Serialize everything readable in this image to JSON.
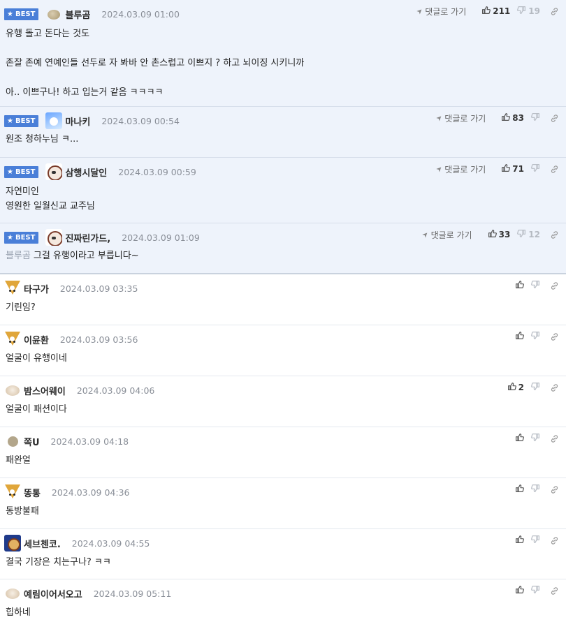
{
  "comments": [
    {
      "best": true,
      "badge": "BEST",
      "nick": "블루곰",
      "date": "2024.03.09 01:00",
      "avatar": "blob",
      "lines": [
        "유행 돌고 돈다는 것도",
        "",
        "존잘 존예 연예인들 선두로 자 봐바 안 촌스럽고 이쁘지 ? 하고 뇌이징 시키니까",
        "",
        "아.. 이쁘구나! 하고 입는거 같음 ㅋㅋㅋㅋ"
      ],
      "reply_label": "댓글로 가기",
      "up": "211",
      "down": "19"
    },
    {
      "best": true,
      "badge": "BEST",
      "nick": "마나키",
      "date": "2024.03.09 00:54",
      "avatar": "blue",
      "lines": [
        "원조 청하누님 ㅋ..."
      ],
      "reply_label": "댓글로 가기",
      "up": "83",
      "down": ""
    },
    {
      "best": true,
      "badge": "BEST",
      "nick": "삼행시달인",
      "date": "2024.03.09 00:59",
      "avatar": "dog",
      "lines": [
        "자연미인",
        "영원한 일월신교 교주님"
      ],
      "reply_label": "댓글로 가기",
      "up": "71",
      "down": ""
    },
    {
      "best": true,
      "badge": "BEST",
      "nick": "진짜린가드,",
      "date": "2024.03.09 01:09",
      "avatar": "dog",
      "mention": "블루곰",
      "lines": [
        "그걸 유행이라고 부릅니다~"
      ],
      "reply_label": "댓글로 가기",
      "up": "33",
      "down": "12"
    },
    {
      "best": false,
      "nick": "타구가",
      "date": "2024.03.09 03:35",
      "avatar": "fox",
      "lines": [
        "기린임?"
      ],
      "up": "",
      "down": ""
    },
    {
      "best": false,
      "nick": "이윤환",
      "date": "2024.03.09 03:56",
      "avatar": "fox",
      "lines": [
        "얼굴이 유행이네"
      ],
      "up": "",
      "down": ""
    },
    {
      "best": false,
      "nick": "밤스어웨이",
      "date": "2024.03.09 04:06",
      "avatar": "puppy",
      "lines": [
        "얼굴이 패션이다"
      ],
      "up": "2",
      "down": ""
    },
    {
      "best": false,
      "nick": "쪽U",
      "date": "2024.03.09 04:18",
      "avatar": "circle",
      "lines": [
        "패완얼"
      ],
      "up": "",
      "down": ""
    },
    {
      "best": false,
      "nick": "똥통",
      "date": "2024.03.09 04:36",
      "avatar": "fox",
      "lines": [
        "동방불패"
      ],
      "up": "",
      "down": ""
    },
    {
      "best": false,
      "nick": "세브첸코.",
      "date": "2024.03.09 04:55",
      "avatar": "lion",
      "lines": [
        "결국 기장은 치는구나? ㅋㅋ"
      ],
      "up": "",
      "down": ""
    },
    {
      "best": false,
      "nick": "예림이어서오고",
      "date": "2024.03.09 05:11",
      "avatar": "puppy",
      "lines": [
        "힙하네"
      ],
      "up": "",
      "down": ""
    }
  ]
}
